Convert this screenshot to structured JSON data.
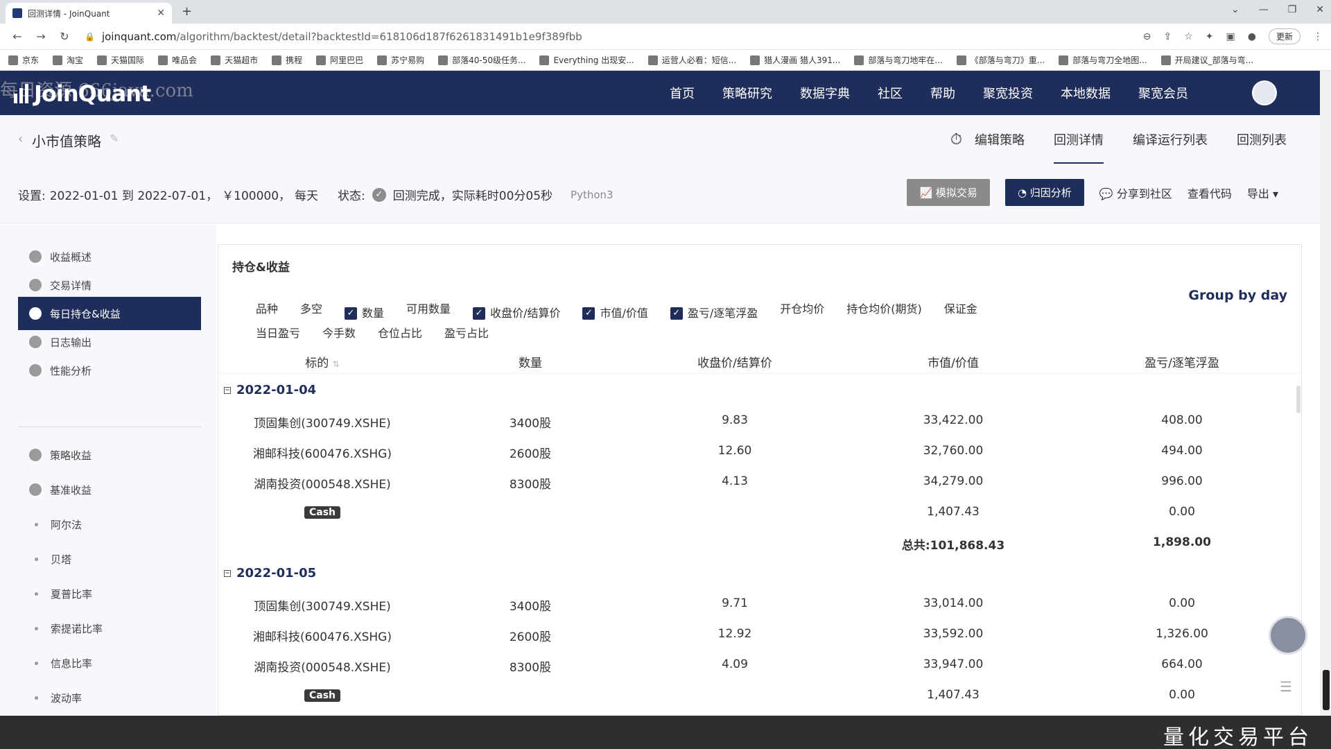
{
  "browser": {
    "tab_title": "回测详情 - JoinQuant",
    "url_host": "joinquant.com",
    "url_path": "/algorithm/backtest/detail?backtestId=618106d187f6261831491b1e9f389fbb",
    "update_label": "更新",
    "bookmarks": [
      "京东",
      "淘宝",
      "天猫国际",
      "唯品会",
      "天猫超市",
      "携程",
      "阿里巴巴",
      "苏宁易购",
      "部落40-50级任务...",
      "Everything 出现安...",
      "运营人必看：短信...",
      "猎人漫画 猎人391...",
      "部落与弯刀地牢在...",
      "《部落与弯刀》重...",
      "部落与弯刀全地图...",
      "开局建议_部落与弯..."
    ]
  },
  "site": {
    "logo": "JoinQuant",
    "watermark": "每日资源 666java.com",
    "nav": [
      "首页",
      "策略研究",
      "数据字典",
      "社区",
      "帮助",
      "聚宽投资",
      "本地数据",
      "聚宽会员"
    ]
  },
  "subheader": {
    "strategy_name": "小市值策略",
    "tabs": [
      "编辑策略",
      "回测详情",
      "编译运行列表",
      "回测列表"
    ]
  },
  "settings": {
    "label": "设置:",
    "range": "2022-01-01 到 2022-07-01，",
    "capital": "￥100000，",
    "freq": "每天",
    "status_label": "状态:",
    "status_text": "回测完成，实际耗时00分05秒",
    "python": "Python3"
  },
  "actions": {
    "simulate": "模拟交易",
    "attribution": "归因分析",
    "share": "分享到社区",
    "view_code": "查看代码",
    "export": "导出"
  },
  "sidebar": {
    "items": [
      "收益概述",
      "交易详情",
      "每日持仓&收益",
      "日志输出",
      "性能分析"
    ],
    "items2": [
      "策略收益",
      "基准收益"
    ],
    "metrics": [
      "阿尔法",
      "贝塔",
      "夏普比率",
      "索提诺比率",
      "信息比率",
      "波动率"
    ]
  },
  "panel": {
    "title": "持仓&收益",
    "group_by": "Group by day",
    "filters": [
      {
        "label": "品种",
        "checked": false
      },
      {
        "label": "多空",
        "checked": false
      },
      {
        "label": "数量",
        "checked": true
      },
      {
        "label": "可用数量",
        "checked": false
      },
      {
        "label": "收盘价/结算价",
        "checked": true
      },
      {
        "label": "市值/价值",
        "checked": true
      },
      {
        "label": "盈亏/逐笔浮盈",
        "checked": true
      },
      {
        "label": "开仓均价",
        "checked": false
      },
      {
        "label": "持仓均价(期货)",
        "checked": false
      },
      {
        "label": "保证金",
        "checked": false
      },
      {
        "label": "当日盈亏",
        "checked": false
      },
      {
        "label": "今手数",
        "checked": false
      },
      {
        "label": "仓位占比",
        "checked": false
      },
      {
        "label": "盈亏占比",
        "checked": false
      }
    ],
    "columns": [
      "标的",
      "数量",
      "收盘价/结算价",
      "市值/价值",
      "盈亏/逐笔浮盈"
    ],
    "groups": [
      {
        "date": "2022-01-04",
        "rows": [
          [
            "顶固集创(300749.XSHE)",
            "3400股",
            "9.83",
            "33,422.00",
            "408.00"
          ],
          [
            "湘邮科技(600476.XSHG)",
            "2600股",
            "12.60",
            "32,760.00",
            "494.00"
          ],
          [
            "湖南投资(000548.XSHE)",
            "8300股",
            "4.13",
            "34,279.00",
            "996.00"
          ]
        ],
        "cash": {
          "label": "Cash",
          "value": "1,407.43",
          "pnl": "0.00"
        },
        "total": {
          "value": "总共:101,868.43",
          "pnl": "1,898.00"
        }
      },
      {
        "date": "2022-01-05",
        "rows": [
          [
            "顶固集创(300749.XSHE)",
            "3400股",
            "9.71",
            "33,014.00",
            "0.00"
          ],
          [
            "湘邮科技(600476.XSHG)",
            "2600股",
            "12.92",
            "33,592.00",
            "1,326.00"
          ],
          [
            "湖南投资(000548.XSHE)",
            "8300股",
            "4.09",
            "33,947.00",
            "664.00"
          ]
        ],
        "cash": {
          "label": "Cash",
          "value": "1,407.43",
          "pnl": "0.00"
        }
      }
    ]
  },
  "footer": {
    "brand": "量化交易平台"
  }
}
